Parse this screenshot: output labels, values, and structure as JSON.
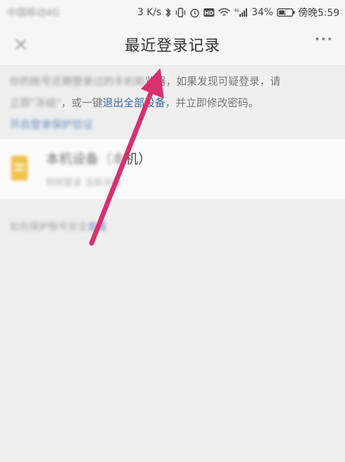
{
  "status_bar": {
    "carrier": "中国移动4G",
    "net_speed": "3 K/s",
    "signal_label": "46",
    "battery": "34%",
    "time": "傍晚5:59"
  },
  "header": {
    "title": "最近登录记录"
  },
  "description": {
    "line1_blurred": "你的账号近期登录过的手机和",
    "line1_after": "览器，如果发现可疑登录，请",
    "line2_blurred": "立即\"冻结\"",
    "line2_mid": "，或一键",
    "line2_link": "退出全部设备",
    "line2_after": "，并立即修改密码。",
    "line3_blurred": "开启登录保护",
    "line3_after": "验证"
  },
  "device": {
    "name_blurred": "本机设备",
    "name_suffix": "机）",
    "meta": "刚刚登录  当前设备"
  },
  "hint": {
    "text_blurred": "如何保护账号安全",
    "link_blurred": "查看"
  },
  "colors": {
    "arrow": "#d8306f",
    "link": "#3a6aa8"
  }
}
